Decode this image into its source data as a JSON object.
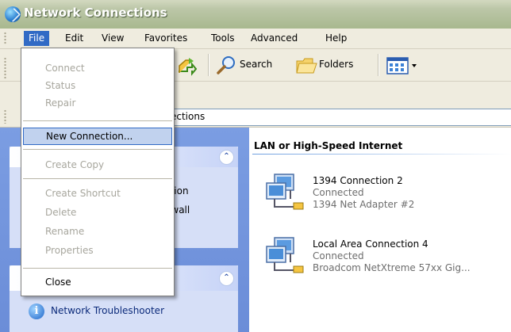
{
  "window": {
    "title": "Network Connections"
  },
  "menubar": {
    "items": [
      "File",
      "Edit",
      "View",
      "Favorites",
      "Tools",
      "Advanced",
      "Help"
    ]
  },
  "toolbar": {
    "search": "Search",
    "folders": "Folders"
  },
  "address": {
    "value": "ections"
  },
  "file_menu": {
    "items": [
      "Connect",
      "Status",
      "Repair",
      "New Connection...",
      "Create Copy",
      "Create Shortcut",
      "Delete",
      "Rename",
      "Properties",
      "Close"
    ]
  },
  "left_pane": {
    "partial_1": "ction",
    "partial_2": "ewall",
    "troubleshooter": "Network Troubleshooter"
  },
  "content": {
    "group_title": "LAN or High-Speed Internet",
    "connections": [
      {
        "name": "1394 Connection 2",
        "status": "Connected",
        "device": "1394 Net Adapter #2"
      },
      {
        "name": "Local Area Connection 4",
        "status": "Connected",
        "device": "Broadcom NetXtreme 57xx Gig..."
      }
    ]
  },
  "colors": {
    "titlebar": "#a8b88f",
    "menu_highlight": "#316ac5",
    "task_pane": "#7b9de2"
  }
}
